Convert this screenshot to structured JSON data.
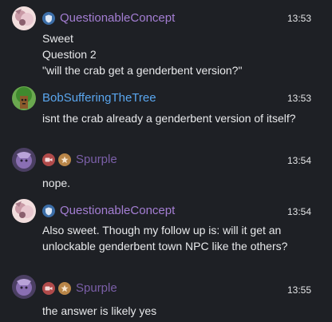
{
  "messages": [
    {
      "username": "QuestionableConcept",
      "name_color": "#a47ed3",
      "time": "13:53",
      "badges": [
        "shield-icon"
      ],
      "lines": [
        "Sweet",
        "Question 2",
        "\"will the crab get a genderbent version?\""
      ]
    },
    {
      "username": "BobSufferingTheTree",
      "name_color": "#5aa6ee",
      "time": "13:53",
      "badges": [],
      "lines": [
        "isnt the crab already a genderbent version of itself?"
      ]
    },
    {
      "username": "Spurple",
      "name_color": "#7b5fa8",
      "time": "13:54",
      "badges": [
        "camera-icon",
        "star-icon"
      ],
      "lines": [
        "nope."
      ]
    },
    {
      "username": "QuestionableConcept",
      "name_color": "#a47ed3",
      "time": "13:54",
      "badges": [
        "shield-icon"
      ],
      "lines": [
        "Also sweet. Though my follow up is: will it get an",
        "unlockable genderbent town NPC like the others?"
      ]
    },
    {
      "username": "Spurple",
      "name_color": "#7b5fa8",
      "time": "13:55",
      "badges": [
        "camera-icon",
        "star-icon"
      ],
      "lines": [
        "the answer is likely yes"
      ]
    }
  ],
  "colors": {
    "background": "#1e2025",
    "text": "#e3e4e6",
    "shield_badge": "#3c6ea8",
    "camera_badge": "#b04a4a",
    "star_badge": "#b88548"
  }
}
